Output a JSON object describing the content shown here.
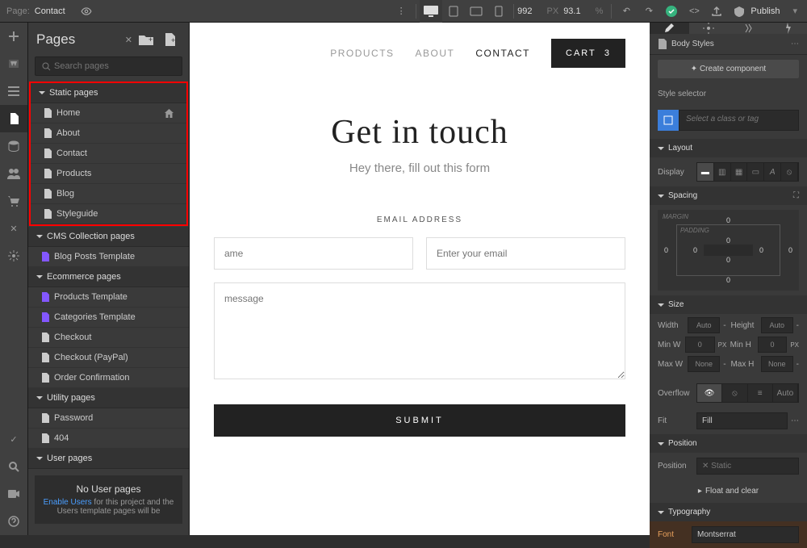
{
  "top": {
    "page_label": "Page:",
    "page_name": "Contact",
    "width": "992",
    "px": "PX",
    "zoom": "93.1",
    "pct": "%",
    "publish": "Publish"
  },
  "pages": {
    "title": "Pages",
    "search_placeholder": "Search pages",
    "folders": {
      "static": "Static pages",
      "cms": "CMS Collection pages",
      "ecom": "Ecommerce pages",
      "utility": "Utility pages",
      "user": "User pages"
    },
    "static": [
      "Home",
      "About",
      "Contact",
      "Products",
      "Blog",
      "Styleguide"
    ],
    "cms": [
      "Blog Posts Template"
    ],
    "ecom": [
      "Products Template",
      "Categories Template",
      "Checkout",
      "Checkout (PayPal)",
      "Order Confirmation"
    ],
    "utility": [
      "Password",
      "404"
    ],
    "info": {
      "title": "No User pages",
      "link": "Enable Users",
      "text": " for this project and the Users template pages will be"
    }
  },
  "canvas": {
    "nav": {
      "products": "PRODUCTS",
      "about": "ABOUT",
      "contact": "CONTACT",
      "cart": "CART",
      "cart_count": "3"
    },
    "hero": {
      "title": "Get in touch",
      "subtitle": "Hey there, fill out this form"
    },
    "form": {
      "label": "EMAIL ADDRESS",
      "name_ph": "ame",
      "email_ph": "Enter your email",
      "msg_ph": "message",
      "submit": "SUBMIT"
    }
  },
  "right": {
    "body_styles": "Body Styles",
    "create": "Create component",
    "selector_label": "Style selector",
    "selector_ph": "Select a class or tag",
    "sections": {
      "layout": "Layout",
      "spacing": "Spacing",
      "size": "Size",
      "position": "Position",
      "typography": "Typography"
    },
    "display": "Display",
    "spacing": {
      "margin": "MARGIN",
      "padding": "PADDING",
      "m_t": "0",
      "m_r": "0",
      "m_b": "0",
      "m_l": "0",
      "p_t": "0",
      "p_r": "0",
      "p_b": "0",
      "p_l": "0"
    },
    "size": {
      "width": "Width",
      "height": "Height",
      "minw": "Min W",
      "minh": "Min H",
      "maxw": "Max W",
      "maxh": "Max H",
      "auto": "Auto",
      "zero": "0",
      "none": "None",
      "px": "PX"
    },
    "overflow": "Overflow",
    "overflow_auto": "Auto",
    "fit": "Fit",
    "fit_val": "Fill",
    "position": "Position",
    "position_val": "Static",
    "float": "Float and clear",
    "font": "Font",
    "font_val": "Montserrat"
  }
}
